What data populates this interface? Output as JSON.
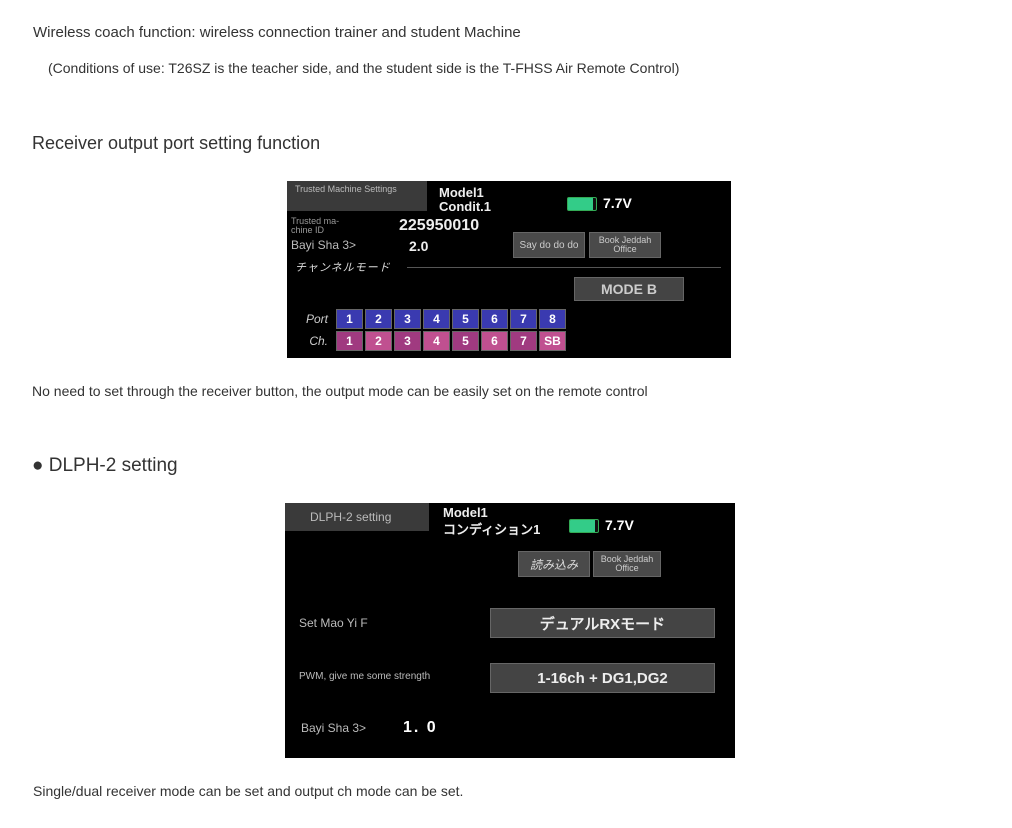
{
  "text": {
    "line1": "Wireless coach function: wireless connection trainer and student Machine",
    "line2": "(Conditions of use: T26SZ is the teacher side, and the student side is the T-FHSS Air Remote Control)",
    "heading1": "Receiver output port setting function",
    "line3": "No need to set through the receiver button, the output mode can be easily set on the remote control",
    "heading2": "● DLPH-2 setting",
    "line4": "Single/dual receiver mode can be set and output ch mode can be set."
  },
  "screen1": {
    "tab": "Trusted Machine Settings",
    "model": "Model1",
    "condit": "Condit.1",
    "voltage": "7.7V",
    "id_label": "Trusted ma-\nchine ID",
    "id_value": "225950010",
    "btn_read": "Say do do do",
    "btn_write": "Book Jeddah Office",
    "ver_label": "Bayi Sha 3>",
    "ver_value": "2.0",
    "section": "チャンネルモード",
    "mode_btn": "MODE B",
    "port_label": "Port",
    "ch_label": "Ch.",
    "ports": [
      "1",
      "2",
      "3",
      "4",
      "5",
      "6",
      "7",
      "8"
    ],
    "chs": [
      "1",
      "2",
      "3",
      "4",
      "5",
      "6",
      "7",
      "SB"
    ]
  },
  "screen2": {
    "tab": "DLPH-2 setting",
    "model": "Model1",
    "condit": "コンディション1",
    "voltage": "7.7V",
    "btn_read": "読み込み",
    "btn_write": "Book Jeddah Office",
    "row1_label": "Set Mao Yi F",
    "row1_value": "デュアルRXモード",
    "row2_label": "PWM, give me some strength",
    "row2_value": "1-16ch + DG1,DG2",
    "ver_label": "Bayi Sha 3>",
    "ver_value": "1. 0"
  }
}
